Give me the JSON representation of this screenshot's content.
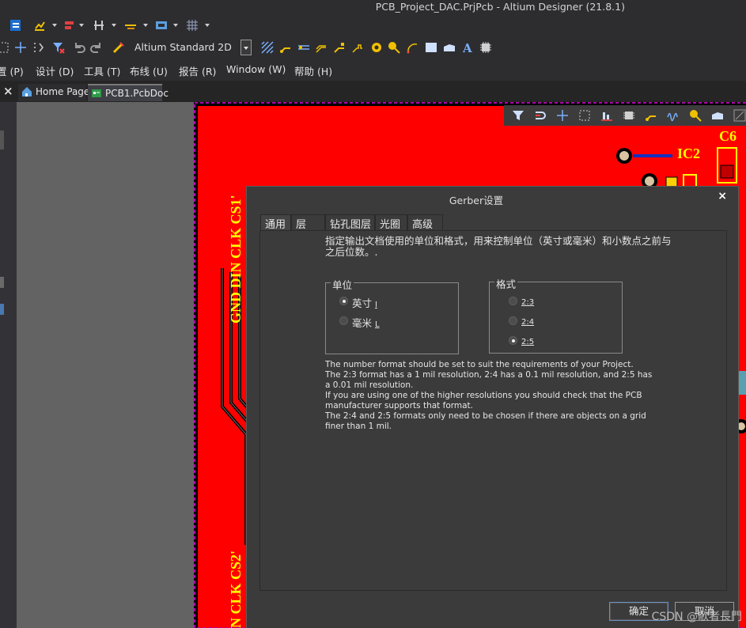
{
  "window": {
    "title": "PCB_Project_DAC.PrjPcb - Altium Designer (21.8.1)"
  },
  "toolbar2": {
    "view_config": "Altium Standard 2D"
  },
  "menubar": {
    "items": [
      {
        "label": "置 (P)"
      },
      {
        "label": "设计 (D)"
      },
      {
        "label": "工具 (T)"
      },
      {
        "label": "布线 (U)"
      },
      {
        "label": "报告 (R)"
      },
      {
        "label": "Window (W)"
      },
      {
        "label": "帮助 (H)"
      }
    ]
  },
  "tabs": {
    "close_glyph": "×",
    "items": [
      {
        "label": "Home Page"
      },
      {
        "label": "PCB1.PcbDoc"
      }
    ]
  },
  "pcb": {
    "labels": {
      "ic2": "IC2",
      "c6": "C6",
      "net_top": "GND DIN CLK CS1'",
      "net_bottom": "N CLK CS2'"
    }
  },
  "dialog": {
    "title": "Gerber设置",
    "close_glyph": "×",
    "tabs": [
      "通用",
      "层",
      "钻孔图层",
      "光圈",
      "高级"
    ],
    "intro": "指定输出文档使用的单位和格式，用来控制单位（英寸或毫米）和小数点之前与之后位数。.",
    "units": {
      "legend": "单位",
      "options": [
        {
          "label": "英寸",
          "key": "I",
          "selected": true
        },
        {
          "label": "毫米",
          "key": "L",
          "selected": false
        }
      ]
    },
    "format": {
      "legend": "格式",
      "options": [
        {
          "label": "2:3",
          "selected": false
        },
        {
          "label": "2:4",
          "selected": false
        },
        {
          "label": "2:5",
          "selected": true
        }
      ]
    },
    "description": [
      "The number format should be set to suit the requirements of your Project.",
      "The 2:3 format has a 1 mil resolution, 2:4 has a 0.1 mil resolution, and 2:5 has a 0.01 mil resolution.",
      "If you are using one of the higher resolutions you should check that the PCB manufacturer supports that format.",
      "The 2:4 and 2:5 formats only need to be chosen if there are objects on a grid finer than 1 mil."
    ],
    "ok_label": "确定",
    "cancel_label": "取消"
  },
  "watermark": "CSDN @歌者長門",
  "colors": {
    "board_red": "#ff0000",
    "keepout_magenta": "#b000b0",
    "silk_yellow": "#ffff00"
  }
}
